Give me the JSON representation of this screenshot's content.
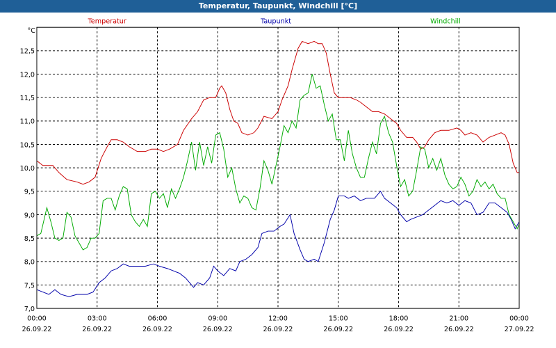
{
  "window": {
    "title": "Temperatur, Taupunkt, Windchill [°C]"
  },
  "chart_data": {
    "type": "line",
    "title": "Temperatur, Taupunkt, Windchill [°C]",
    "ylabel": "°C",
    "xlim": [
      0,
      24
    ],
    "ylim": [
      7.0,
      13.0
    ],
    "y_ticks": [
      "7,0",
      "7,5",
      "8,0",
      "8,5",
      "9,0",
      "9,5",
      "10,0",
      "10,5",
      "11,0",
      "11,5",
      "12,0",
      "12,5"
    ],
    "x_ticks": [
      {
        "t": 0,
        "time": "00:00",
        "date": "26.09.22"
      },
      {
        "t": 3,
        "time": "03:00",
        "date": "26.09.22"
      },
      {
        "t": 6,
        "time": "06:00",
        "date": "26.09.22"
      },
      {
        "t": 9,
        "time": "09:00",
        "date": "26.09.22"
      },
      {
        "t": 12,
        "time": "12:00",
        "date": "26.09.22"
      },
      {
        "t": 15,
        "time": "15:00",
        "date": "26.09.22"
      },
      {
        "t": 18,
        "time": "18:00",
        "date": "26.09.22"
      },
      {
        "t": 21,
        "time": "21:00",
        "date": "26.09.22"
      },
      {
        "t": 24,
        "time": "00:00",
        "date": "27.09.22"
      }
    ],
    "grid": true,
    "colors": {
      "temperatur": "#cc0000",
      "taupunkt": "#0000aa",
      "windchill": "#00aa00"
    },
    "series": [
      {
        "name": "Temperatur",
        "color": "#cc0000",
        "points": [
          [
            0,
            10.15
          ],
          [
            0.3,
            10.05
          ],
          [
            0.8,
            10.05
          ],
          [
            1.1,
            9.9
          ],
          [
            1.5,
            9.75
          ],
          [
            2.0,
            9.7
          ],
          [
            2.3,
            9.65
          ],
          [
            2.6,
            9.7
          ],
          [
            2.9,
            9.8
          ],
          [
            3.2,
            10.2
          ],
          [
            3.5,
            10.45
          ],
          [
            3.7,
            10.6
          ],
          [
            4.0,
            10.6
          ],
          [
            4.3,
            10.55
          ],
          [
            4.6,
            10.45
          ],
          [
            5.0,
            10.35
          ],
          [
            5.4,
            10.35
          ],
          [
            5.7,
            10.4
          ],
          [
            6.0,
            10.4
          ],
          [
            6.3,
            10.35
          ],
          [
            6.6,
            10.4
          ],
          [
            7.0,
            10.5
          ],
          [
            7.3,
            10.8
          ],
          [
            7.7,
            11.05
          ],
          [
            8.0,
            11.2
          ],
          [
            8.3,
            11.45
          ],
          [
            8.6,
            11.5
          ],
          [
            8.9,
            11.5
          ],
          [
            9.1,
            11.7
          ],
          [
            9.2,
            11.75
          ],
          [
            9.4,
            11.6
          ],
          [
            9.6,
            11.25
          ],
          [
            9.8,
            11.0
          ],
          [
            10.0,
            10.95
          ],
          [
            10.2,
            10.75
          ],
          [
            10.5,
            10.7
          ],
          [
            10.8,
            10.75
          ],
          [
            11.0,
            10.85
          ],
          [
            11.3,
            11.1
          ],
          [
            11.7,
            11.05
          ],
          [
            12.0,
            11.2
          ],
          [
            12.2,
            11.45
          ],
          [
            12.5,
            11.75
          ],
          [
            12.7,
            12.1
          ],
          [
            13.0,
            12.55
          ],
          [
            13.2,
            12.7
          ],
          [
            13.5,
            12.65
          ],
          [
            13.8,
            12.7
          ],
          [
            14.0,
            12.65
          ],
          [
            14.2,
            12.65
          ],
          [
            14.4,
            12.45
          ],
          [
            14.6,
            12.0
          ],
          [
            14.8,
            11.6
          ],
          [
            15.0,
            11.5
          ],
          [
            15.3,
            11.5
          ],
          [
            15.6,
            11.5
          ],
          [
            15.9,
            11.45
          ],
          [
            16.1,
            11.4
          ],
          [
            16.4,
            11.3
          ],
          [
            16.7,
            11.2
          ],
          [
            17.0,
            11.2
          ],
          [
            17.3,
            11.15
          ],
          [
            17.6,
            11.05
          ],
          [
            17.9,
            10.95
          ],
          [
            18.1,
            10.8
          ],
          [
            18.4,
            10.65
          ],
          [
            18.7,
            10.65
          ],
          [
            18.9,
            10.55
          ],
          [
            19.1,
            10.4
          ],
          [
            19.3,
            10.45
          ],
          [
            19.5,
            10.6
          ],
          [
            19.8,
            10.75
          ],
          [
            20.1,
            10.8
          ],
          [
            20.5,
            10.8
          ],
          [
            20.9,
            10.85
          ],
          [
            21.1,
            10.8
          ],
          [
            21.3,
            10.7
          ],
          [
            21.6,
            10.75
          ],
          [
            21.9,
            10.7
          ],
          [
            22.2,
            10.55
          ],
          [
            22.5,
            10.65
          ],
          [
            22.8,
            10.7
          ],
          [
            23.1,
            10.75
          ],
          [
            23.3,
            10.7
          ],
          [
            23.5,
            10.5
          ],
          [
            23.7,
            10.1
          ],
          [
            23.9,
            9.9
          ],
          [
            24.0,
            9.9
          ]
        ]
      },
      {
        "name": "Taupunkt",
        "color": "#0000aa",
        "points": [
          [
            0,
            7.4
          ],
          [
            0.3,
            7.35
          ],
          [
            0.6,
            7.3
          ],
          [
            0.9,
            7.4
          ],
          [
            1.2,
            7.3
          ],
          [
            1.6,
            7.25
          ],
          [
            2.0,
            7.3
          ],
          [
            2.5,
            7.3
          ],
          [
            2.8,
            7.35
          ],
          [
            3.1,
            7.55
          ],
          [
            3.4,
            7.65
          ],
          [
            3.7,
            7.8
          ],
          [
            4.0,
            7.85
          ],
          [
            4.3,
            7.95
          ],
          [
            4.6,
            7.9
          ],
          [
            5.0,
            7.9
          ],
          [
            5.4,
            7.9
          ],
          [
            5.8,
            7.95
          ],
          [
            6.1,
            7.9
          ],
          [
            6.5,
            7.85
          ],
          [
            6.8,
            7.8
          ],
          [
            7.1,
            7.75
          ],
          [
            7.4,
            7.65
          ],
          [
            7.8,
            7.45
          ],
          [
            8.0,
            7.55
          ],
          [
            8.3,
            7.5
          ],
          [
            8.6,
            7.65
          ],
          [
            8.8,
            7.9
          ],
          [
            9.0,
            7.8
          ],
          [
            9.3,
            7.7
          ],
          [
            9.6,
            7.85
          ],
          [
            9.9,
            7.8
          ],
          [
            10.1,
            8.0
          ],
          [
            10.4,
            8.05
          ],
          [
            10.7,
            8.15
          ],
          [
            11.0,
            8.3
          ],
          [
            11.2,
            8.6
          ],
          [
            11.5,
            8.65
          ],
          [
            11.8,
            8.65
          ],
          [
            12.1,
            8.75
          ],
          [
            12.3,
            8.8
          ],
          [
            12.6,
            9.0
          ],
          [
            12.8,
            8.6
          ],
          [
            13.1,
            8.25
          ],
          [
            13.3,
            8.05
          ],
          [
            13.5,
            8.0
          ],
          [
            13.8,
            8.05
          ],
          [
            14.0,
            8.0
          ],
          [
            14.3,
            8.4
          ],
          [
            14.6,
            8.9
          ],
          [
            14.8,
            9.1
          ],
          [
            15.0,
            9.4
          ],
          [
            15.3,
            9.4
          ],
          [
            15.5,
            9.35
          ],
          [
            15.8,
            9.4
          ],
          [
            16.1,
            9.3
          ],
          [
            16.4,
            9.35
          ],
          [
            16.8,
            9.35
          ],
          [
            17.1,
            9.5
          ],
          [
            17.3,
            9.35
          ],
          [
            17.6,
            9.25
          ],
          [
            17.9,
            9.15
          ],
          [
            18.1,
            9.0
          ],
          [
            18.4,
            8.85
          ],
          [
            18.6,
            8.9
          ],
          [
            18.9,
            8.95
          ],
          [
            19.2,
            9.0
          ],
          [
            19.5,
            9.1
          ],
          [
            19.8,
            9.2
          ],
          [
            20.1,
            9.3
          ],
          [
            20.4,
            9.25
          ],
          [
            20.7,
            9.3
          ],
          [
            21.0,
            9.2
          ],
          [
            21.3,
            9.3
          ],
          [
            21.6,
            9.25
          ],
          [
            21.9,
            9.0
          ],
          [
            22.2,
            9.05
          ],
          [
            22.5,
            9.25
          ],
          [
            22.8,
            9.25
          ],
          [
            23.1,
            9.15
          ],
          [
            23.4,
            9.05
          ],
          [
            23.6,
            8.9
          ],
          [
            23.8,
            8.7
          ],
          [
            24.0,
            8.85
          ]
        ]
      },
      {
        "name": "Windchill",
        "color": "#00aa00",
        "points": [
          [
            0,
            8.55
          ],
          [
            0.2,
            8.6
          ],
          [
            0.5,
            9.15
          ],
          [
            0.7,
            8.85
          ],
          [
            0.9,
            8.5
          ],
          [
            1.1,
            8.45
          ],
          [
            1.3,
            8.5
          ],
          [
            1.5,
            9.05
          ],
          [
            1.7,
            8.95
          ],
          [
            1.9,
            8.55
          ],
          [
            2.1,
            8.4
          ],
          [
            2.3,
            8.25
          ],
          [
            2.5,
            8.3
          ],
          [
            2.7,
            8.5
          ],
          [
            2.9,
            8.5
          ],
          [
            3.1,
            8.6
          ],
          [
            3.3,
            9.3
          ],
          [
            3.5,
            9.35
          ],
          [
            3.7,
            9.35
          ],
          [
            3.9,
            9.1
          ],
          [
            4.1,
            9.4
          ],
          [
            4.3,
            9.6
          ],
          [
            4.5,
            9.55
          ],
          [
            4.7,
            9.0
          ],
          [
            4.9,
            8.85
          ],
          [
            5.1,
            8.75
          ],
          [
            5.3,
            8.9
          ],
          [
            5.5,
            8.75
          ],
          [
            5.7,
            9.45
          ],
          [
            5.9,
            9.5
          ],
          [
            6.1,
            9.35
          ],
          [
            6.3,
            9.45
          ],
          [
            6.5,
            9.15
          ],
          [
            6.7,
            9.55
          ],
          [
            6.9,
            9.35
          ],
          [
            7.1,
            9.55
          ],
          [
            7.3,
            9.8
          ],
          [
            7.5,
            10.15
          ],
          [
            7.7,
            10.55
          ],
          [
            7.9,
            9.95
          ],
          [
            8.1,
            10.55
          ],
          [
            8.3,
            10.05
          ],
          [
            8.5,
            10.45
          ],
          [
            8.7,
            10.1
          ],
          [
            8.9,
            10.7
          ],
          [
            9.1,
            10.75
          ],
          [
            9.3,
            10.4
          ],
          [
            9.5,
            9.8
          ],
          [
            9.7,
            10.0
          ],
          [
            9.9,
            9.55
          ],
          [
            10.1,
            9.25
          ],
          [
            10.3,
            9.4
          ],
          [
            10.5,
            9.35
          ],
          [
            10.7,
            9.15
          ],
          [
            10.9,
            9.1
          ],
          [
            11.1,
            9.55
          ],
          [
            11.3,
            10.15
          ],
          [
            11.5,
            9.95
          ],
          [
            11.7,
            9.65
          ],
          [
            11.9,
            10.05
          ],
          [
            12.1,
            10.45
          ],
          [
            12.3,
            10.9
          ],
          [
            12.5,
            10.75
          ],
          [
            12.7,
            11.0
          ],
          [
            12.9,
            10.85
          ],
          [
            13.1,
            11.45
          ],
          [
            13.3,
            11.55
          ],
          [
            13.5,
            11.6
          ],
          [
            13.7,
            12.0
          ],
          [
            13.9,
            11.7
          ],
          [
            14.1,
            11.75
          ],
          [
            14.3,
            11.35
          ],
          [
            14.5,
            11.0
          ],
          [
            14.7,
            11.15
          ],
          [
            14.9,
            10.6
          ],
          [
            15.1,
            10.6
          ],
          [
            15.3,
            10.15
          ],
          [
            15.5,
            10.8
          ],
          [
            15.7,
            10.3
          ],
          [
            15.9,
            10.0
          ],
          [
            16.1,
            9.8
          ],
          [
            16.3,
            9.8
          ],
          [
            16.5,
            10.2
          ],
          [
            16.7,
            10.55
          ],
          [
            16.9,
            10.3
          ],
          [
            17.1,
            10.95
          ],
          [
            17.3,
            11.1
          ],
          [
            17.5,
            10.75
          ],
          [
            17.7,
            10.55
          ],
          [
            17.9,
            10.05
          ],
          [
            18.1,
            9.6
          ],
          [
            18.3,
            9.75
          ],
          [
            18.5,
            9.4
          ],
          [
            18.7,
            9.5
          ],
          [
            18.9,
            9.95
          ],
          [
            19.1,
            10.45
          ],
          [
            19.3,
            10.4
          ],
          [
            19.5,
            10.0
          ],
          [
            19.7,
            10.2
          ],
          [
            19.9,
            9.95
          ],
          [
            20.1,
            10.2
          ],
          [
            20.3,
            9.85
          ],
          [
            20.5,
            9.65
          ],
          [
            20.7,
            9.55
          ],
          [
            20.9,
            9.6
          ],
          [
            21.1,
            9.8
          ],
          [
            21.3,
            9.65
          ],
          [
            21.5,
            9.4
          ],
          [
            21.7,
            9.5
          ],
          [
            21.9,
            9.75
          ],
          [
            22.1,
            9.6
          ],
          [
            22.3,
            9.7
          ],
          [
            22.5,
            9.55
          ],
          [
            22.7,
            9.65
          ],
          [
            22.9,
            9.45
          ],
          [
            23.1,
            9.35
          ],
          [
            23.3,
            9.35
          ],
          [
            23.5,
            9.0
          ],
          [
            23.7,
            8.85
          ],
          [
            23.9,
            8.7
          ],
          [
            24.0,
            8.8
          ]
        ]
      }
    ]
  }
}
